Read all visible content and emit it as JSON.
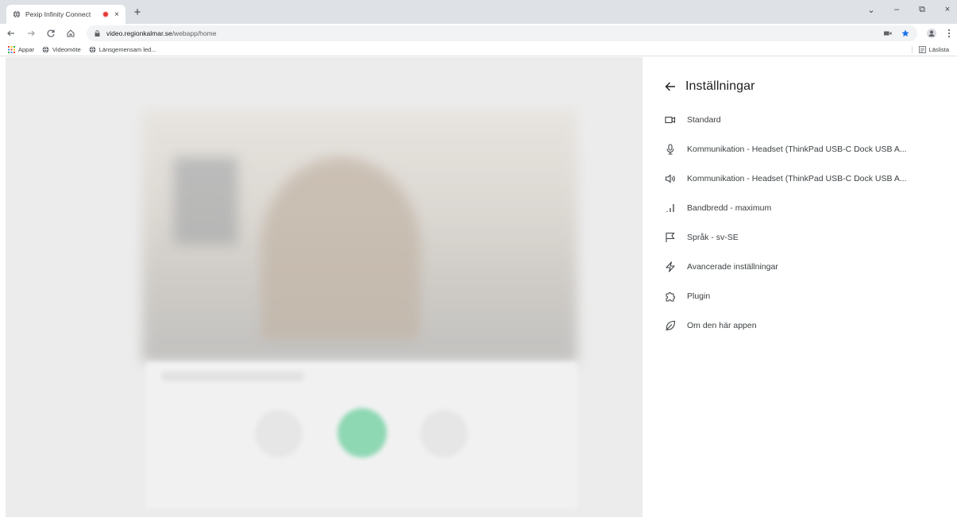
{
  "browser": {
    "tab_title": "Pexip Infinity Connect",
    "tab_close": "×",
    "new_tab": "+",
    "url_host": "video.regionkalmar.se",
    "url_path": "/webapp/home",
    "window_controls": [
      "⌄",
      "–",
      "⧉",
      "×"
    ]
  },
  "bookmarks": {
    "items": [
      {
        "label": "Appar",
        "icon": "apps-grid-icon"
      },
      {
        "label": "Videomöte",
        "icon": "globe-icon"
      },
      {
        "label": "Länsgemensam led..."
      }
    ],
    "reading_list": "Läslista"
  },
  "settings": {
    "title": "Inställningar",
    "items": [
      {
        "icon": "camera-icon",
        "label": "Standard"
      },
      {
        "icon": "microphone-icon",
        "label": "Kommunikation - Headset (ThinkPad USB-C Dock USB A..."
      },
      {
        "icon": "speaker-icon",
        "label": "Kommunikation - Headset (ThinkPad USB-C Dock USB A..."
      },
      {
        "icon": "bandwidth-icon",
        "label": "Bandbredd - maximum"
      },
      {
        "icon": "flag-icon",
        "label": "Språk - sv-SE"
      },
      {
        "icon": "lightning-icon",
        "label": "Avancerade inställningar"
      },
      {
        "icon": "puzzle-icon",
        "label": "Plugin"
      },
      {
        "icon": "leaf-icon",
        "label": "Om den här appen"
      }
    ]
  },
  "colors": {
    "accent_green": "#8fd8b4",
    "record_dot": "#e53935",
    "star_blue": "#1a73e8"
  }
}
